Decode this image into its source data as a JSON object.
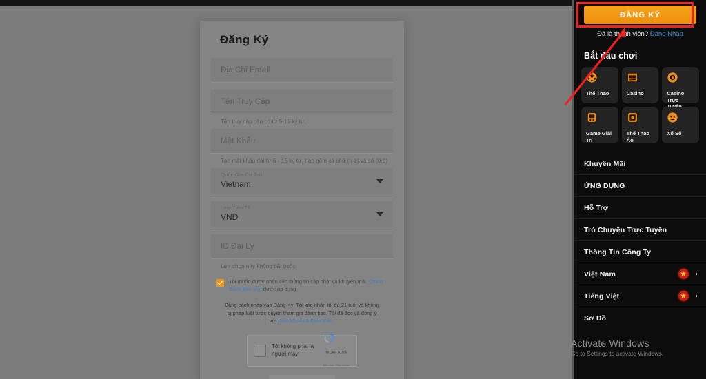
{
  "modal": {
    "title": "Đăng Ký",
    "fields": [
      {
        "name": "email",
        "placeholder": "Địa Chỉ Email",
        "helper": ""
      },
      {
        "name": "username",
        "placeholder": "Tên Truy Cập",
        "helper": "Tên truy cập cần có từ 5-15 ký tự."
      },
      {
        "name": "password",
        "placeholder": "Mật Khẩu",
        "helper": "Tạo mật khẩu dài từ 6 - 15 ký tự, bao gồm cả chữ (a-z) và số (0-9)"
      }
    ],
    "selects": [
      {
        "name": "country",
        "label": "Quốc Gia Cư Trú",
        "value": "Vietnam"
      },
      {
        "name": "currency",
        "label": "Loại Tiền Tệ",
        "value": "VND"
      }
    ],
    "agent_field": {
      "placeholder": "ID Đại Lý",
      "helper": "Lựa chọn này không bắt buộc"
    },
    "consent": {
      "text_before": "Tôi muốn được nhận các thông tin cập nhật và khuyến mãi.",
      "link": "Chính Sách Bảo Mật",
      "text_after": "được áp dụng",
      "checked": true
    },
    "terms": {
      "line1": "Bằng cách nhấp vào Đăng Ký, Tôi xác nhận tôi đủ 21 tuổi và không bị",
      "line2": "pháp luật tước quyền tham gia đánh bạc. Tôi đã đọc và đồng ý với",
      "link": "Điều khoản & Điều Kiện."
    },
    "captcha": {
      "label": "Tôi không phải là người máy",
      "brand": "reCAPTCHA",
      "sub": "Bảo mật - Điều khoản"
    }
  },
  "sidebar": {
    "signup_label": "ĐĂNG KÝ",
    "member_prompt": "Đã là thành viên?",
    "login_label": "Đăng Nhập",
    "start_playing_title": "Bắt đầu chơi",
    "tiles": [
      {
        "label": "Thể Thao",
        "icon": "soccer-ball-icon"
      },
      {
        "label": "Casino",
        "icon": "slot-machine-icon"
      },
      {
        "label": "Casino Trực Tuyến",
        "icon": "roulette-icon"
      },
      {
        "label": "Game Giải Trí",
        "icon": "arcade-icon"
      },
      {
        "label": "Thể Thao Ảo",
        "icon": "virtual-sports-icon"
      },
      {
        "label": "Xổ Số",
        "icon": "lottery-ball-icon"
      }
    ],
    "menu": [
      {
        "label": "Khuyến Mãi",
        "type": "plain"
      },
      {
        "label": "ỨNG DỤNG",
        "type": "plain"
      },
      {
        "label": "Hỗ Trợ",
        "type": "plain"
      },
      {
        "label": "Trò Chuyện Trực Tuyến",
        "type": "plain"
      },
      {
        "label": "Thông Tin Công Ty",
        "type": "plain"
      },
      {
        "label": "Việt Nam",
        "type": "flag"
      },
      {
        "label": "Tiếng Việt",
        "type": "flag"
      },
      {
        "label": "Sơ Đồ",
        "type": "plain"
      }
    ]
  },
  "watermark": {
    "title": "Activate Windows",
    "subtitle": "Go to Settings to activate Windows."
  },
  "colors": {
    "accent_orange": "#f59b12",
    "annotation_red": "#ef2020",
    "link_blue": "#3f93d8",
    "sidebar_bg": "#0c0c0c",
    "overlay_gray": "#7b7b7b"
  }
}
